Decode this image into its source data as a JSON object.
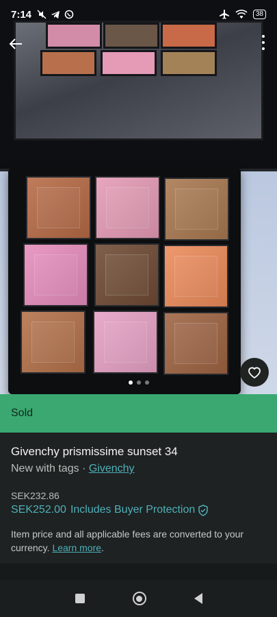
{
  "status_bar": {
    "time": "7:14",
    "battery": "38",
    "icons_left": [
      "mute-icon",
      "telegram-icon",
      "viber-icon"
    ],
    "icons_right": [
      "airplane-icon",
      "wifi-icon",
      "battery-icon"
    ]
  },
  "photo": {
    "palette_colors": [
      "#b56a45",
      "#e49ab4",
      "#a8784f",
      "#e58cbc",
      "#6e4a33",
      "#ec8a5a",
      "#b37048",
      "#e6a0c4",
      "#9e6342"
    ],
    "mirror_colors": [
      "#d28ca8",
      "#6a5748",
      "#c86a48",
      "#b8704c",
      "#e59ab6",
      "#a48258"
    ]
  },
  "listing": {
    "status_label": "Sold",
    "title": "Givenchy prismissime sunset 34",
    "condition": "New with tags",
    "separator": " · ",
    "brand": "Givenchy",
    "price": "SEK232.86",
    "price_with_protection": "SEK252.00",
    "protection_label": "Includes Buyer Protection",
    "note": "Item price and all applicable fees are converted to your currency.",
    "learn_more": "Learn more",
    "note_end": "."
  },
  "colors": {
    "sold_banner": "#3aa870",
    "link": "#4fb0ba",
    "background": "#1e2222"
  }
}
